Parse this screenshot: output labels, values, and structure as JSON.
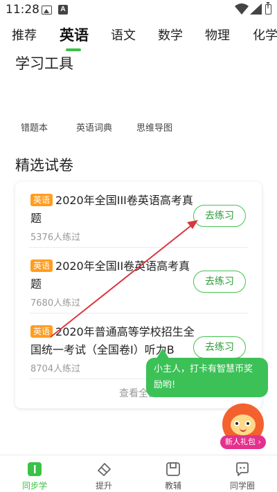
{
  "status_bar": {
    "time": "11:28",
    "icons": [
      "image-icon",
      "a-icon",
      "wifi-icon",
      "signal-icon",
      "battery-alert-icon"
    ]
  },
  "tabs": [
    {
      "label": "推荐",
      "active": false
    },
    {
      "label": "英语",
      "active": true
    },
    {
      "label": "语文",
      "active": false
    },
    {
      "label": "数学",
      "active": false
    },
    {
      "label": "物理",
      "active": false
    },
    {
      "label": "化学",
      "active": false
    }
  ],
  "study_tools": {
    "title": "学习工具",
    "items": [
      "错题本",
      "英语词典",
      "思维导图"
    ]
  },
  "papers": {
    "title": "精选试卷",
    "items": [
      {
        "badge": "英语",
        "title": "2020年全国III卷英语高考真题",
        "count": "5376人练过",
        "button": "去练习"
      },
      {
        "badge": "英语",
        "title": "2020年全国II卷英语高考真题",
        "count": "7680人练过",
        "button": "去练习"
      },
      {
        "badge": "英语",
        "title": "2020年普通高等学校招生全国统一考试（全国卷I）听力B",
        "count": "8704人练过",
        "button": "去练习"
      }
    ],
    "view_all": "查看全部"
  },
  "tooltip": {
    "text": "小主人，打卡有智慧币奖励哟!"
  },
  "gift": {
    "label": "新人礼包 ›"
  },
  "bottom_nav": [
    {
      "label": "同步学",
      "icon": "book-icon",
      "active": true
    },
    {
      "label": "提升",
      "icon": "eraser-icon",
      "active": false
    },
    {
      "label": "教辅",
      "icon": "workbook-icon",
      "active": false
    },
    {
      "label": "同学圈",
      "icon": "chat-icon",
      "active": false
    }
  ],
  "colors": {
    "accent": "#38c246",
    "badge": "#ff9d1f",
    "annotation_arrow": "#d9363e",
    "bubble": "#3cc157",
    "gift_label": "#e4318e"
  }
}
